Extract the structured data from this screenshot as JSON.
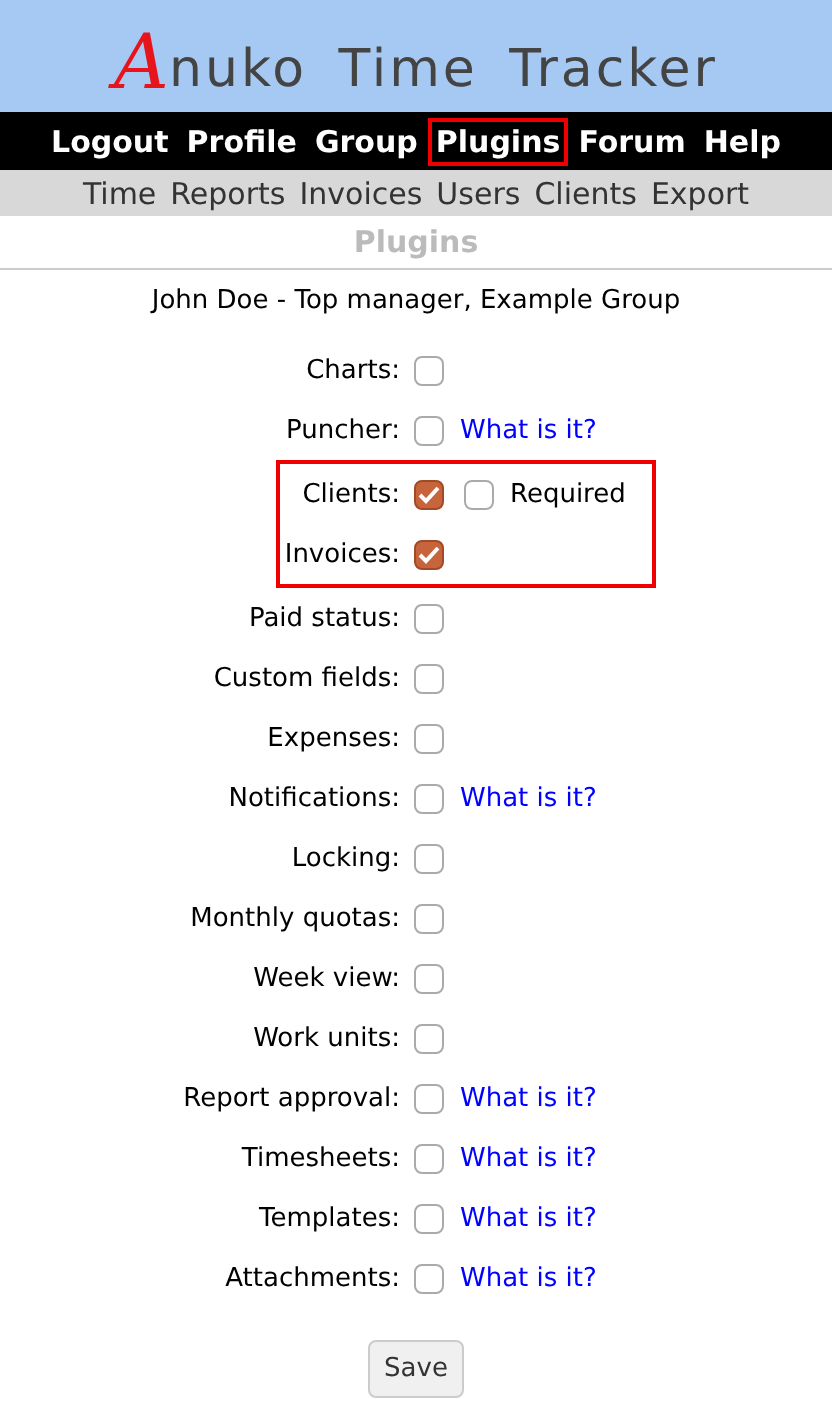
{
  "logo": {
    "initial": "A",
    "text": "nuko Time Tracker"
  },
  "main_menu": [
    {
      "label": "Logout",
      "highlighted": false
    },
    {
      "label": "Profile",
      "highlighted": false
    },
    {
      "label": "Group",
      "highlighted": false
    },
    {
      "label": "Plugins",
      "highlighted": true
    },
    {
      "label": "Forum",
      "highlighted": false
    },
    {
      "label": "Help",
      "highlighted": false
    }
  ],
  "sub_menu": [
    "Time",
    "Reports",
    "Invoices",
    "Users",
    "Clients",
    "Export"
  ],
  "page_title": "Plugins",
  "user_line": "John Doe - Top manager, Example Group",
  "plugins": [
    {
      "label": "Charts:",
      "checked": false,
      "highlighted": false
    },
    {
      "label": "Puncher:",
      "checked": false,
      "highlighted": false,
      "link": "What is it?"
    },
    {
      "label": "Clients:",
      "checked": true,
      "highlighted": true,
      "option": {
        "label": "Required",
        "checked": false
      }
    },
    {
      "label": "Invoices:",
      "checked": true,
      "highlighted": true
    },
    {
      "label": "Paid status:",
      "checked": false,
      "highlighted": false
    },
    {
      "label": "Custom fields:",
      "checked": false,
      "highlighted": false
    },
    {
      "label": "Expenses:",
      "checked": false,
      "highlighted": false
    },
    {
      "label": "Notifications:",
      "checked": false,
      "highlighted": false,
      "link": "What is it?"
    },
    {
      "label": "Locking:",
      "checked": false,
      "highlighted": false
    },
    {
      "label": "Monthly quotas:",
      "checked": false,
      "highlighted": false
    },
    {
      "label": "Week view:",
      "checked": false,
      "highlighted": false
    },
    {
      "label": "Work units:",
      "checked": false,
      "highlighted": false
    },
    {
      "label": "Report approval:",
      "checked": false,
      "highlighted": false,
      "link": "What is it?"
    },
    {
      "label": "Timesheets:",
      "checked": false,
      "highlighted": false,
      "link": "What is it?"
    },
    {
      "label": "Templates:",
      "checked": false,
      "highlighted": false,
      "link": "What is it?"
    },
    {
      "label": "Attachments:",
      "checked": false,
      "highlighted": false,
      "link": "What is it?"
    }
  ],
  "save_button": "Save"
}
